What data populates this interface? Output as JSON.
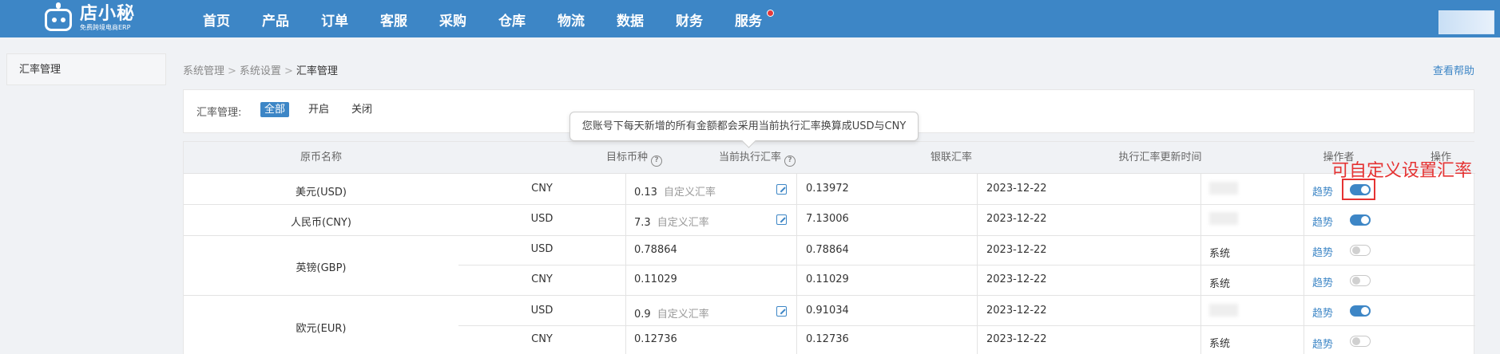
{
  "app": {
    "logo_name": "店小秘",
    "logo_sub": "免费跨境电商ERP",
    "nav": [
      "首页",
      "产品",
      "订单",
      "客服",
      "采购",
      "仓库",
      "物流",
      "数据",
      "财务",
      "服务"
    ]
  },
  "sidebar": {
    "items": [
      {
        "label": "汇率管理"
      }
    ]
  },
  "breadcrumb": {
    "items": [
      "系统管理",
      "系统设置",
      "汇率管理"
    ]
  },
  "help_link": "查看帮助",
  "filter": {
    "label": "汇率管理:",
    "options": [
      "全部",
      "开启",
      "关闭"
    ],
    "selected": "全部"
  },
  "tooltip": "您账号下每天新增的所有金额都会采用当前执行汇率换算成USD与CNY",
  "annotation": "可自定义设置汇率",
  "table": {
    "columns": [
      "原币名称",
      "目标币种",
      "当前执行汇率",
      "银联汇率",
      "执行汇率更新时间",
      "操作者",
      "操作"
    ],
    "trend_label": "趋势",
    "custom_label": "自定义汇率",
    "rows": [
      {
        "currency": "美元(USD)",
        "target": "CNY",
        "rate": "0.13",
        "custom": true,
        "unionpay": "0.13972",
        "updated": "2023-12-22",
        "operator": "",
        "enabled": true
      },
      {
        "currency": "人民币(CNY)",
        "target": "USD",
        "rate": "7.3",
        "custom": true,
        "unionpay": "7.13006",
        "updated": "2023-12-22",
        "operator": "",
        "enabled": true
      },
      {
        "currency": "英镑(GBP)",
        "target": "USD",
        "rate": "0.78864",
        "custom": false,
        "unionpay": "0.78864",
        "updated": "2023-12-22",
        "operator": "系统",
        "enabled": false
      },
      {
        "currency": "",
        "target": "CNY",
        "rate": "0.11029",
        "custom": false,
        "unionpay": "0.11029",
        "updated": "2023-12-22",
        "operator": "系统",
        "enabled": false
      },
      {
        "currency": "欧元(EUR)",
        "target": "USD",
        "rate": "0.9",
        "custom": true,
        "unionpay": "0.91034",
        "updated": "2023-12-22",
        "operator": "",
        "enabled": true
      },
      {
        "currency": "",
        "target": "CNY",
        "rate": "0.12736",
        "custom": false,
        "unionpay": "0.12736",
        "updated": "2023-12-22",
        "operator": "系统",
        "enabled": false
      }
    ]
  },
  "colors": {
    "primary": "#3d86c6",
    "annotation": "#e53333",
    "badge": "#e4393c"
  }
}
